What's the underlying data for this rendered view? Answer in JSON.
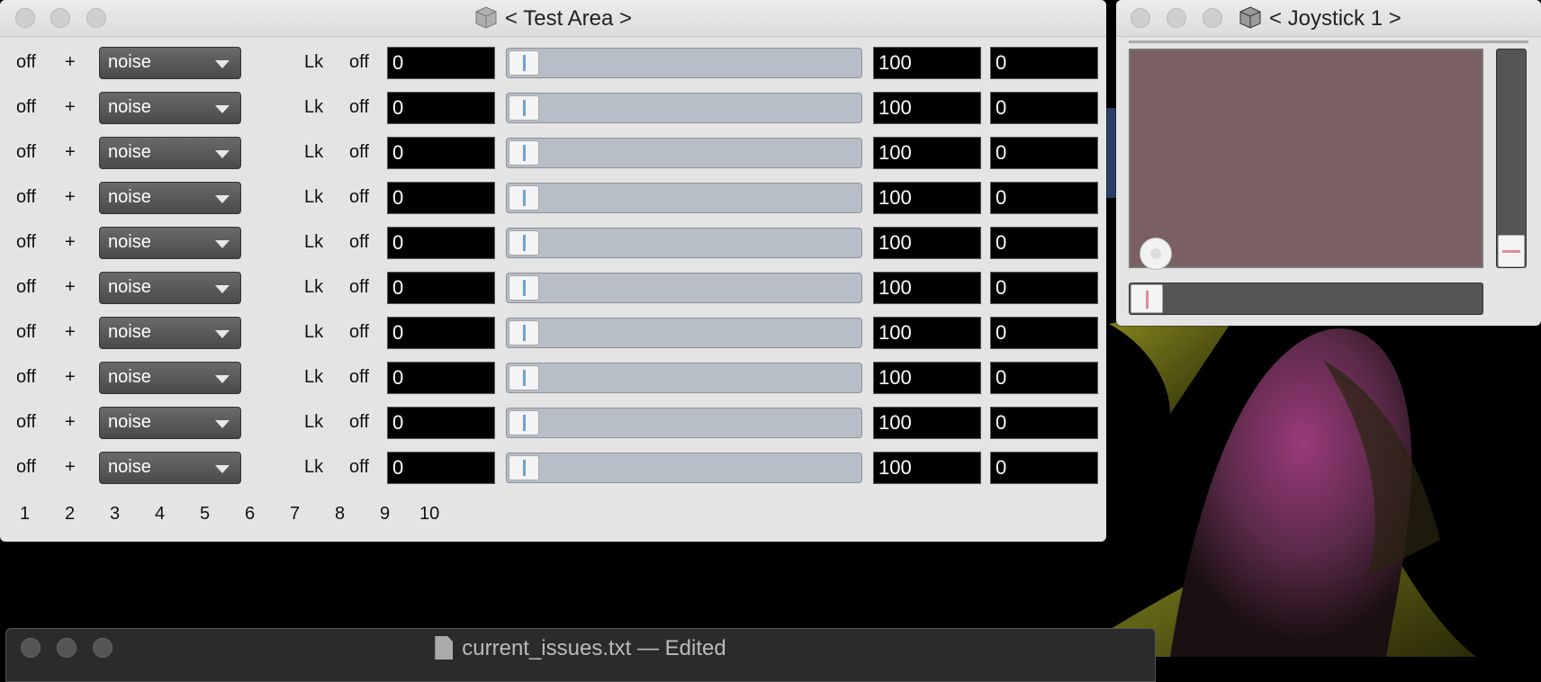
{
  "test_area": {
    "title": "< Test Area >",
    "rows": [
      {
        "state": "off",
        "plus": "+",
        "mode": "noise",
        "lock": "Lk",
        "lock_state": "off",
        "value": "0",
        "max": "100",
        "min": "0"
      },
      {
        "state": "off",
        "plus": "+",
        "mode": "noise",
        "lock": "Lk",
        "lock_state": "off",
        "value": "0",
        "max": "100",
        "min": "0"
      },
      {
        "state": "off",
        "plus": "+",
        "mode": "noise",
        "lock": "Lk",
        "lock_state": "off",
        "value": "0",
        "max": "100",
        "min": "0"
      },
      {
        "state": "off",
        "plus": "+",
        "mode": "noise",
        "lock": "Lk",
        "lock_state": "off",
        "value": "0",
        "max": "100",
        "min": "0"
      },
      {
        "state": "off",
        "plus": "+",
        "mode": "noise",
        "lock": "Lk",
        "lock_state": "off",
        "value": "0",
        "max": "100",
        "min": "0"
      },
      {
        "state": "off",
        "plus": "+",
        "mode": "noise",
        "lock": "Lk",
        "lock_state": "off",
        "value": "0",
        "max": "100",
        "min": "0"
      },
      {
        "state": "off",
        "plus": "+",
        "mode": "noise",
        "lock": "Lk",
        "lock_state": "off",
        "value": "0",
        "max": "100",
        "min": "0"
      },
      {
        "state": "off",
        "plus": "+",
        "mode": "noise",
        "lock": "Lk",
        "lock_state": "off",
        "value": "0",
        "max": "100",
        "min": "0"
      },
      {
        "state": "off",
        "plus": "+",
        "mode": "noise",
        "lock": "Lk",
        "lock_state": "off",
        "value": "0",
        "max": "100",
        "min": "0"
      },
      {
        "state": "off",
        "plus": "+",
        "mode": "noise",
        "lock": "Lk",
        "lock_state": "off",
        "value": "0",
        "max": "100",
        "min": "0"
      }
    ],
    "channel_numbers": [
      "1",
      "2",
      "3",
      "4",
      "5",
      "6",
      "7",
      "8",
      "9",
      "10"
    ]
  },
  "joystick": {
    "title": "< Joystick 1 >",
    "pad_color": "#7a6063"
  },
  "editor": {
    "title": "current_issues.txt — Edited"
  },
  "icons": {
    "window_icon": "cube-icon",
    "document_icon": "document-icon"
  }
}
